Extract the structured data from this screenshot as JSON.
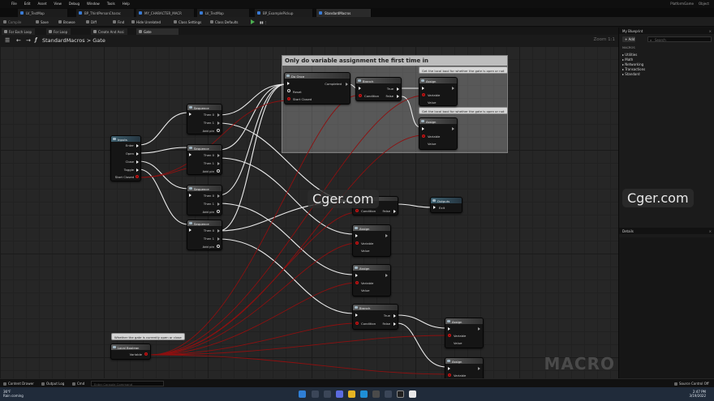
{
  "window": {
    "menu": [
      "File",
      "Edit",
      "Asset",
      "View",
      "Debug",
      "Window",
      "Tools",
      "Help"
    ],
    "top_right": [
      "PlatformGame",
      "Object"
    ]
  },
  "doc_tabs": [
    "LV_TestMap",
    "BP_ThirdPersonCharac",
    "MY_CHARACTER_MACR",
    "LV_TestMap",
    "BP_ExamplePickup",
    "StandardMacros"
  ],
  "toolbar": {
    "compile": "Compile",
    "save": "Save",
    "browse": "Browse",
    "diff": "Diff",
    "find": "Find",
    "hide_unrelated": "Hide Unrelated",
    "class_settings": "Class Settings",
    "class_defaults": "Class Defaults"
  },
  "graph_tabs": [
    "For Each Loop",
    "For Loop",
    "Create And Assi",
    "Gate"
  ],
  "breadcrumb": {
    "root": "StandardMacros",
    "sep": ">",
    "current": "Gate",
    "zoom": "Zoom 1:1"
  },
  "comment": {
    "title": "Only do variable assignment the first time in"
  },
  "bubbles": {
    "b1": "Get the local bool for whether the gate is open or not",
    "b2": "Get the local bool for whether the gate is open or not",
    "b3": "Whether the gate is currently open or close"
  },
  "nodes": {
    "inputs": {
      "title": "Inputs",
      "pins": [
        "Enter",
        "Open",
        "Close",
        "Toggle",
        "Start Closed"
      ]
    },
    "seq1": {
      "title": "Sequence",
      "pins": [
        "Then 0",
        "Then 1",
        "Add pin"
      ]
    },
    "seq2": {
      "title": "Sequence",
      "pins": [
        "Then 0",
        "Then 1",
        "Add pin"
      ]
    },
    "seq3": {
      "title": "Sequence",
      "pins": [
        "Then 0",
        "Then 1",
        "Add pin"
      ]
    },
    "seq4": {
      "title": "Sequence",
      "pins": [
        "Then 0",
        "Then 1",
        "Add pin"
      ]
    },
    "do_once": {
      "title": "Do Once",
      "pins": [
        "Completed",
        "Reset",
        "Start Closed"
      ]
    },
    "branch1": {
      "title": "Branch",
      "pins": [
        "True",
        "Condition",
        "False"
      ]
    },
    "assign1": {
      "title": "Assign",
      "pins": [
        "Variable",
        "Value"
      ]
    },
    "assign2": {
      "title": "Assign",
      "pins": [
        "Variable",
        "Value"
      ]
    },
    "branch2": {
      "title": "Branch",
      "pins": [
        "Condition",
        "False"
      ]
    },
    "outputs": {
      "title": "Outputs",
      "pins": [
        "Exit"
      ]
    },
    "assign3": {
      "title": "Assign",
      "pins": [
        "Variable",
        "Value"
      ]
    },
    "assign4": {
      "title": "Assign",
      "pins": [
        "Variable",
        "Value"
      ]
    },
    "branch3": {
      "title": "Branch",
      "pins": [
        "True",
        "Condition",
        "False"
      ]
    },
    "assign5": {
      "title": "Assign",
      "pins": [
        "Variable",
        "Value"
      ]
    },
    "assign6": {
      "title": "Assign",
      "pins": [
        "Variable"
      ]
    },
    "local_bool": {
      "title": "Local Boolean",
      "pins": [
        "Variable"
      ]
    }
  },
  "watermark": "Cger.com",
  "macro_label": "MACRO",
  "right_panel": {
    "title": "My Blueprint",
    "add": "+ Add",
    "search_placeholder": "Search",
    "section": "MACROS",
    "items": [
      "Utilities",
      "Math",
      "Networking",
      "Transactions",
      "Standard"
    ],
    "details_title": "Details"
  },
  "bottom": {
    "content_drawer": "Content Drawer",
    "output_log": "Output Log",
    "cmd": "Cmd",
    "cmd_placeholder": "Enter Console Command",
    "source_control": "Source Control Off"
  },
  "taskbar": {
    "weather_temp": "36°F",
    "weather_desc": "Rain coming",
    "time": "2:47 PM",
    "date": "3/19/2022"
  }
}
